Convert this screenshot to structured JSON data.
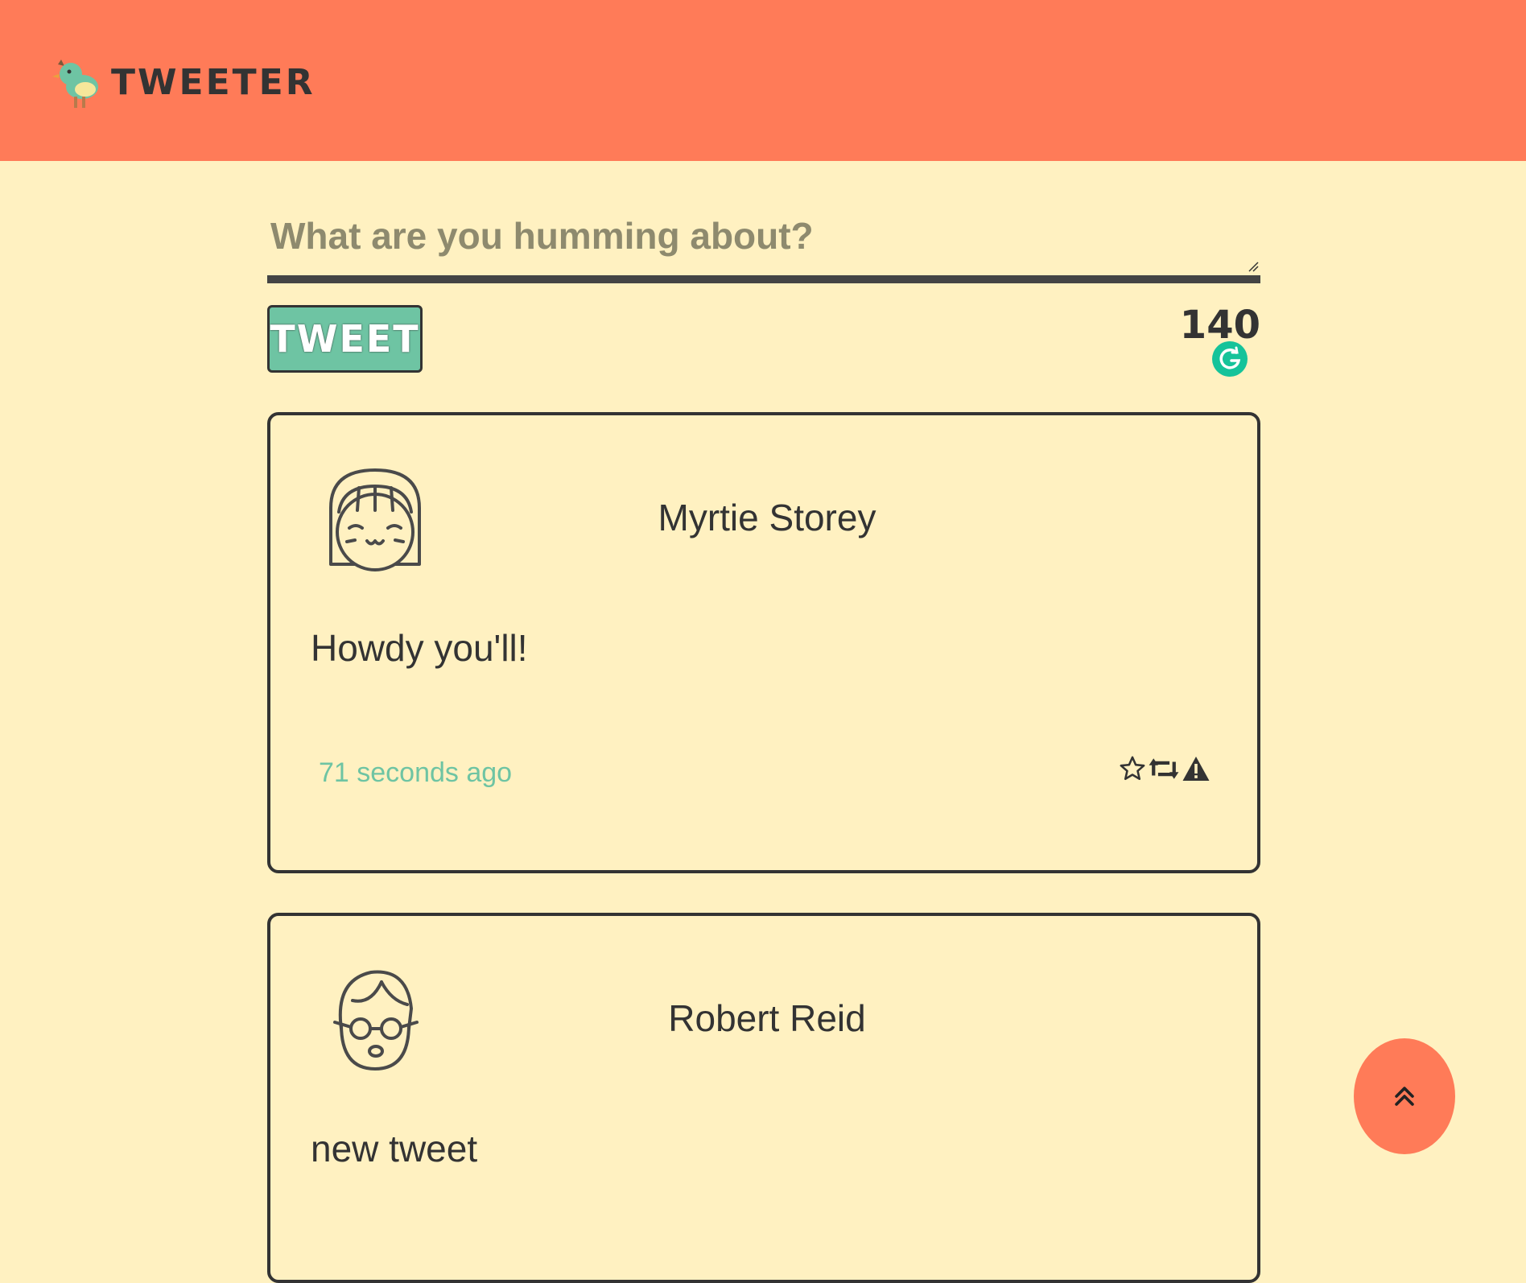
{
  "app": {
    "brand_name": "TWEETER",
    "colors": {
      "header": "#ff7b58",
      "background": "#fff1c1",
      "accent": "#6ec4a3",
      "text": "#333333"
    }
  },
  "compose": {
    "placeholder": "What are you humming about?",
    "tweet_button_label": "TWEET",
    "char_counter": "140"
  },
  "tweets": [
    {
      "author": "Myrtie Storey",
      "avatar_icon": "girl-face-avatar-icon",
      "body": "Howdy you'll!",
      "timestamp": "71 seconds ago",
      "actions": [
        "star-icon",
        "retweet-icon",
        "flag-icon"
      ]
    },
    {
      "author": "Robert Reid",
      "avatar_icon": "boy-glasses-avatar-icon",
      "body": "new tweet"
    }
  ],
  "scroll_top_icon": "double-chevron-up-icon"
}
